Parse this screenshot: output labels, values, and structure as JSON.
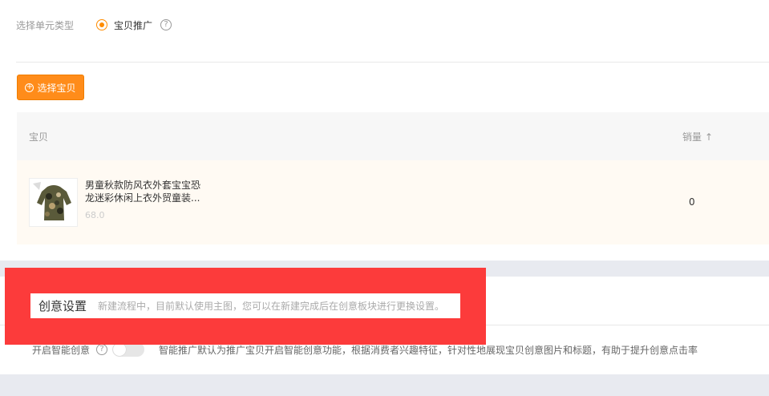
{
  "unit_type": {
    "label": "选择单元类型",
    "option_label": "宝贝推广",
    "help_icon": "question-circle-icon"
  },
  "select_button": {
    "label": "选择宝贝",
    "icon": "plus-circle-icon"
  },
  "table": {
    "headers": {
      "item": "宝贝",
      "sales": "销量",
      "sort_icon": "↑"
    },
    "rows": [
      {
        "title_line1": "男童秋款防风衣外套宝宝恐",
        "title_line2": "龙迷彩休闲上衣外贸童装...",
        "price": "68.0",
        "sales": "0"
      }
    ]
  },
  "creative": {
    "title": "创意设置",
    "description": "新建流程中，目前默认使用主图，您可以在新建完成后在创意板块进行更换设置。"
  },
  "smart_creative": {
    "label": "开启智能创意",
    "help_icon": "question-circle-icon",
    "enabled": false,
    "description": "智能推广默认为推广宝贝开启智能创意功能，根据消费者兴趣特征，针对性地展现宝贝创意图片和标题，有助于提升创意点击率"
  },
  "colors": {
    "accent": "#ff8c1a",
    "overlay_red": "#fc3b3b",
    "row_highlight": "#fffaf3"
  }
}
